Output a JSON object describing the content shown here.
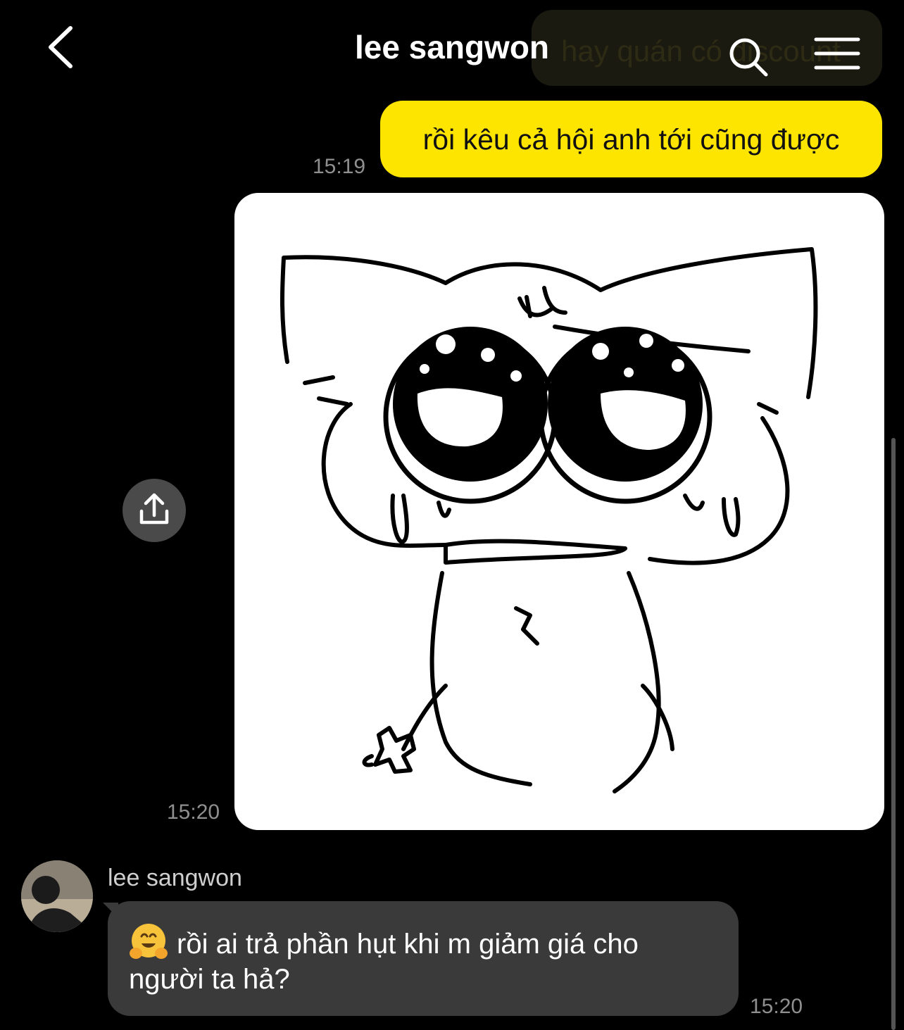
{
  "header": {
    "title": "lee sangwon",
    "ghost_text": "hay quán có discount"
  },
  "messages": {
    "outgoing_text": "rồi kêu cả hội anh tới cũng được",
    "outgoing_time": "15:19",
    "image_time": "15:20",
    "incoming_sender": "lee sangwon",
    "incoming_text": "rồi ai trả phần hụt khi m giảm giá cho người ta hả?",
    "incoming_time": "15:20",
    "incoming_emoji": "hugging-face-emoji"
  },
  "icons": {
    "back": "back-chevron-icon",
    "search": "search-icon",
    "menu": "hamburger-menu-icon",
    "share": "share-upload-icon"
  },
  "colors": {
    "background": "#000000",
    "outgoing_bubble": "#fee500",
    "incoming_bubble": "#3a3a3a",
    "timestamp": "#8f8f8f"
  }
}
